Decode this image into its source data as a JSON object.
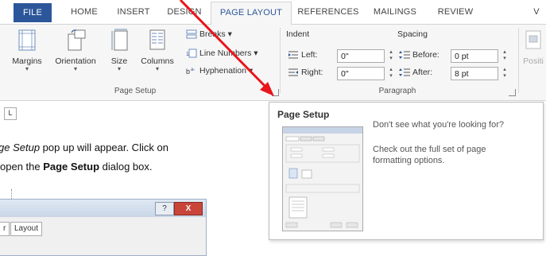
{
  "tabs": [
    {
      "label": "FILE"
    },
    {
      "label": "HOME"
    },
    {
      "label": "INSERT"
    },
    {
      "label": "DESIGN"
    },
    {
      "label": "PAGE LAYOUT"
    },
    {
      "label": "REFERENCES"
    },
    {
      "label": "MAILINGS"
    },
    {
      "label": "REVIEW"
    },
    {
      "label": "V"
    }
  ],
  "page_setup": {
    "margins": "Margins",
    "orientation": "Orientation",
    "size": "Size",
    "columns": "Columns",
    "breaks": "Breaks",
    "line_numbers": "Line Numbers",
    "hyphenation": "Hyphenation",
    "group_label": "Page Setup"
  },
  "paragraph": {
    "indent_label": "Indent",
    "spacing_label": "Spacing",
    "left_label": "Left:",
    "left_value": "0\"",
    "right_label": "Right:",
    "right_value": "0\"",
    "before_label": "Before:",
    "before_value": "0 pt",
    "after_label": "After:",
    "after_value": "8 pt",
    "group_label": "Paragraph"
  },
  "position_label": "Positi",
  "ruler_symbol": "L",
  "instruction": {
    "line1_italic": "ge Setup",
    "line1_rest": " pop up will appear. Click on",
    "line2_pre": "open the ",
    "line2_bold": "Page Setup",
    "line2_post": " dialog box."
  },
  "tooltip": {
    "title": "Page Setup",
    "line1": "Don't see what you're looking for?",
    "line2": "Check out the full set of page formatting options."
  },
  "dialog": {
    "help": "?",
    "close": "X",
    "tab_partial": "r",
    "tab_layout": "Layout"
  },
  "colors": {
    "file_tab": "#2b579a",
    "active_tab_text": "#2b579a",
    "arrow": "#e8151b"
  }
}
